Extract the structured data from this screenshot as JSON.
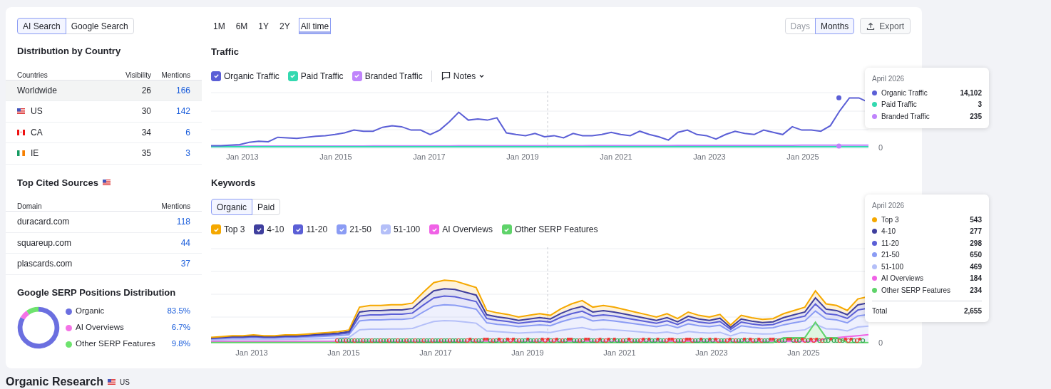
{
  "source_tabs": [
    {
      "label": "AI Search",
      "selected": true
    },
    {
      "label": "Google Search",
      "selected": false
    }
  ],
  "distribution": {
    "title": "Distribution by Country",
    "columns": [
      "Countries",
      "Visibility",
      "Mentions"
    ],
    "rows": [
      {
        "country": "Worldwide",
        "kind": "plain",
        "visibility": "26",
        "mentions": "166",
        "selected": true
      },
      {
        "country": "US",
        "kind": "us",
        "visibility": "30",
        "mentions": "142",
        "selected": false
      },
      {
        "country": "CA",
        "kind": "ca",
        "visibility": "34",
        "mentions": "6",
        "selected": false
      },
      {
        "country": "IE",
        "kind": "ie",
        "visibility": "35",
        "mentions": "3",
        "selected": false
      }
    ]
  },
  "cited_sources": {
    "title": "Top Cited Sources",
    "flag": {
      "kind": "us"
    },
    "columns": [
      "Domain",
      "Mentions"
    ],
    "rows": [
      {
        "domain": "duracard.com",
        "mentions": "118"
      },
      {
        "domain": "squareup.com",
        "mentions": "44"
      },
      {
        "domain": "plascards.com",
        "mentions": "37"
      }
    ]
  },
  "serp": {
    "title": "Google SERP Positions Distribution",
    "chart_data": {
      "type": "donut",
      "categories": [
        "Organic",
        "AI Overviews",
        "Other SERP Features"
      ],
      "values": [
        83.5,
        6.7,
        9.8
      ]
    },
    "items": [
      {
        "value": "83.5%",
        "color": "#6b6fe0"
      },
      {
        "value": "6.7%",
        "color": "#f472e6"
      },
      {
        "value": "9.8%",
        "color": "#6ee36e"
      }
    ]
  },
  "range_tabs": [
    {
      "label": "1M",
      "selected": false
    },
    {
      "label": "6M",
      "selected": false
    },
    {
      "label": "1Y",
      "selected": false
    },
    {
      "label": "2Y",
      "selected": false
    },
    {
      "label": "All time",
      "selected": true
    }
  ],
  "granularity": [
    {
      "label": "Days",
      "selected": false
    },
    {
      "label": "Months",
      "selected": true
    }
  ],
  "export_label": "Export",
  "traffic": {
    "title": "Traffic",
    "legend": [
      {
        "label": "Organic Traffic",
        "checked": true,
        "color": "#5b5fd6"
      },
      {
        "label": "Paid Traffic",
        "checked": true,
        "color": "#34d9b0"
      },
      {
        "label": "Branded Traffic",
        "checked": true,
        "color": "#c084fc"
      }
    ],
    "notes_label": "Notes",
    "x_labels": [
      "Jan 2013",
      "Jan 2015",
      "Jan 2017",
      "Jan 2019",
      "Jan 2021",
      "Jan 2023",
      "Jan 2025"
    ],
    "y_label": "0",
    "tooltip": {
      "title": "April 2026",
      "rows": [
        {
          "label": "Organic Traffic",
          "value": "14,102",
          "color": "#5b5fd6"
        },
        {
          "label": "Paid Traffic",
          "value": "3",
          "color": "#34d9b0"
        },
        {
          "label": "Branded Traffic",
          "value": "235",
          "color": "#c084fc"
        }
      ]
    }
  },
  "keywords": {
    "title": "Keywords",
    "tabs": [
      {
        "label": "Organic",
        "selected": true
      },
      {
        "label": "Paid",
        "selected": false
      }
    ],
    "legend": [
      {
        "label": "Top 3",
        "checked": true,
        "color": "#f5a800"
      },
      {
        "label": "4-10",
        "checked": true,
        "color": "#3f3f9e"
      },
      {
        "label": "11-20",
        "checked": true,
        "color": "#5b5fd6"
      },
      {
        "label": "21-50",
        "checked": true,
        "color": "#8b9cf4"
      },
      {
        "label": "51-100",
        "checked": true,
        "color": "#b4bff8"
      },
      {
        "label": "AI Overviews",
        "checked": true,
        "color": "#f062e6"
      },
      {
        "label": "Other SERP Features",
        "checked": true,
        "color": "#5fd36a"
      }
    ],
    "x_labels": [
      "Jan 2013",
      "Jan 2015",
      "Jan 2017",
      "Jan 2019",
      "Jan 2021",
      "Jan 2023",
      "Jan 2025"
    ],
    "y_label": "0",
    "tooltip": {
      "title": "April 2026",
      "rows": [
        {
          "label": "Top 3",
          "value": "543",
          "color": "#f5a800"
        },
        {
          "label": "4-10",
          "value": "277",
          "color": "#3f3f9e"
        },
        {
          "label": "11-20",
          "value": "298",
          "color": "#5b5fd6"
        },
        {
          "label": "21-50",
          "value": "650",
          "color": "#8b9cf4"
        },
        {
          "label": "51-100",
          "value": "469",
          "color": "#b4bff8"
        },
        {
          "label": "AI Overviews",
          "value": "184",
          "color": "#f062e6"
        },
        {
          "label": "Other SERP Features",
          "value": "234",
          "color": "#5fd36a"
        }
      ],
      "total_label": "Total",
      "total_value": "2,655"
    }
  },
  "organic_research": {
    "title": "Organic Research",
    "flag": {
      "kind": "us"
    },
    "region": "US"
  }
}
